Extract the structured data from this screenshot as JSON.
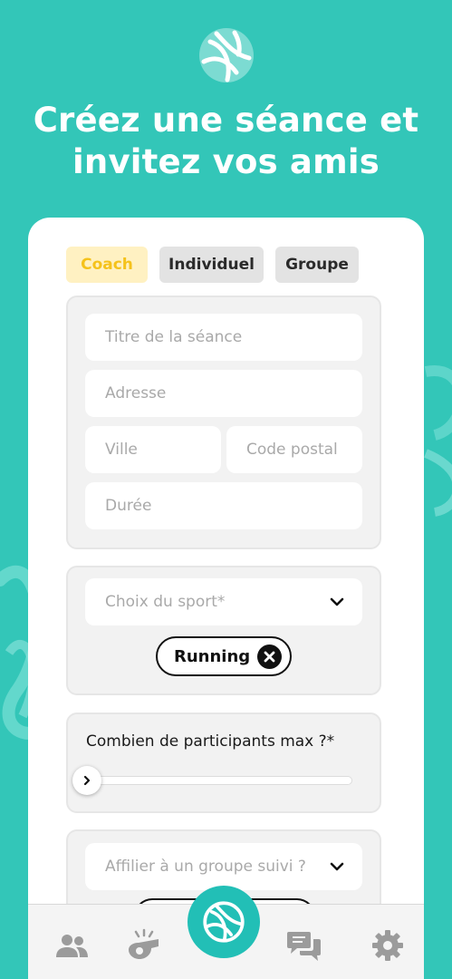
{
  "headline": {
    "line1": "Créez une séance et",
    "line2": "invitez vos amis"
  },
  "tabs": {
    "coach": "Coach",
    "individuel": "Individuel",
    "groupe": "Groupe"
  },
  "form": {
    "titre_placeholder": "Titre de la séance",
    "adresse_placeholder": "Adresse",
    "ville_placeholder": "Ville",
    "code_postal_placeholder": "Code postal",
    "duree_placeholder": "Durée"
  },
  "sport": {
    "select_placeholder": "Choix du sport*",
    "selected_chip": "Running"
  },
  "participants": {
    "label": "Combien de participants max ?*"
  },
  "groupe": {
    "select_placeholder": "Affilier à un groupe suivi ?"
  },
  "colors": {
    "background": "#33c6b8",
    "accent_yellow": "#f5c21b",
    "center_button": "#22bfb6"
  },
  "icons": {
    "logo": "volleyball-icon",
    "nav": [
      "users-icon",
      "whistle-icon",
      "volleyball-icon",
      "chat-icon",
      "gear-icon"
    ]
  }
}
